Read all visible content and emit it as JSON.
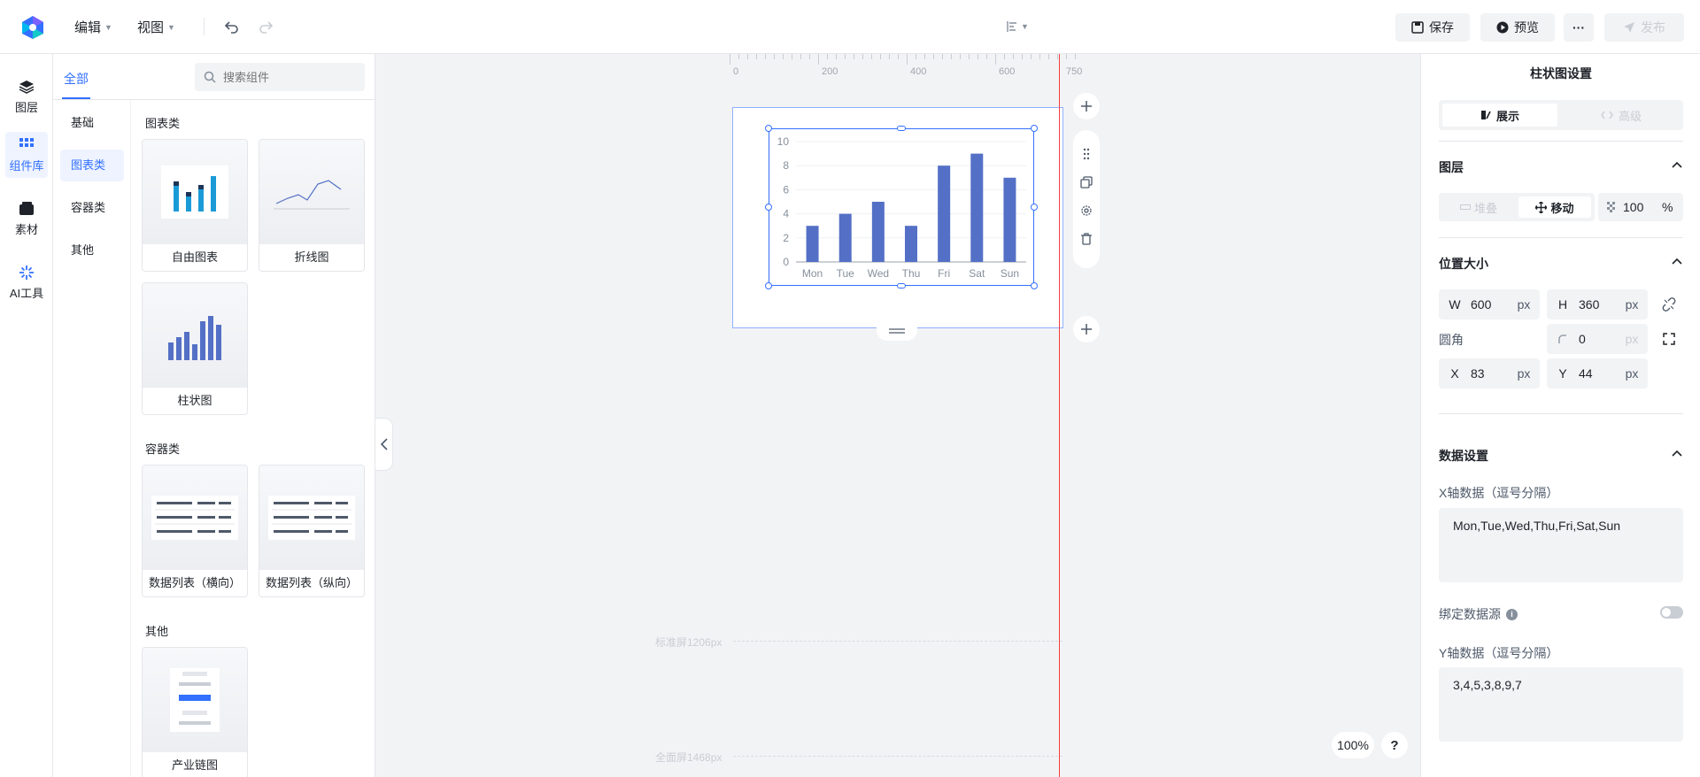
{
  "topbar": {
    "menus": [
      "编辑",
      "视图"
    ],
    "save_label": "保存",
    "preview_label": "预览",
    "more_label": "···",
    "publish_label": "发布"
  },
  "rail": {
    "items": [
      "图层",
      "组件库",
      "素材",
      "AI工具"
    ]
  },
  "panel": {
    "tab_all": "全部",
    "search_placeholder": "搜索组件",
    "categories": [
      "基础",
      "图表类",
      "容器类",
      "其他"
    ],
    "sections": {
      "charts": "图表类",
      "containers": "容器类",
      "others": "其他"
    },
    "cards": {
      "free_chart": "自由图表",
      "line_chart": "折线图",
      "bar_chart": "柱状图",
      "list_h": "数据列表（横向）",
      "list_v": "数据列表（纵向）",
      "industry_chain": "产业链图"
    }
  },
  "canvas": {
    "ruler": [
      "0",
      "200",
      "400",
      "600",
      "750"
    ],
    "guide_standard": "标准屏1206px",
    "guide_full": "全面屏1468px",
    "zoom": "100%",
    "help": "?"
  },
  "chart_data": {
    "type": "bar",
    "categories": [
      "Mon",
      "Tue",
      "Wed",
      "Thu",
      "Fri",
      "Sat",
      "Sun"
    ],
    "values": [
      3,
      4,
      5,
      3,
      8,
      9,
      7
    ],
    "ylim": [
      0,
      10
    ],
    "yticks": [
      "0",
      "2",
      "4",
      "6",
      "8",
      "10"
    ],
    "color": "#5470c6"
  },
  "rpanel": {
    "title": "柱状图设置",
    "tab_display": "展示",
    "tab_advanced": "高级",
    "layer_title": "图层",
    "layer_stack": "堆叠",
    "layer_move": "移动",
    "opacity": "100",
    "opacity_unit": "%",
    "pos_title": "位置大小",
    "w_label": "W",
    "w_value": "600",
    "h_label": "H",
    "h_value": "360",
    "radius_label": "圆角",
    "radius_value": "0",
    "x_label": "X",
    "x_value": "83",
    "y_label": "Y",
    "y_value": "44",
    "unit_px": "px",
    "data_title": "数据设置",
    "x_data_label": "X轴数据（逗号分隔）",
    "x_data_value": "Mon,Tue,Wed,Thu,Fri,Sat,Sun",
    "bind_label": "绑定数据源",
    "y_data_label": "Y轴数据（逗号分隔）",
    "y_data_value": "3,4,5,3,8,9,7"
  },
  "colors": {
    "accent": "#3370ff",
    "guide": "#f53f3f",
    "bar": "#5470c6"
  }
}
